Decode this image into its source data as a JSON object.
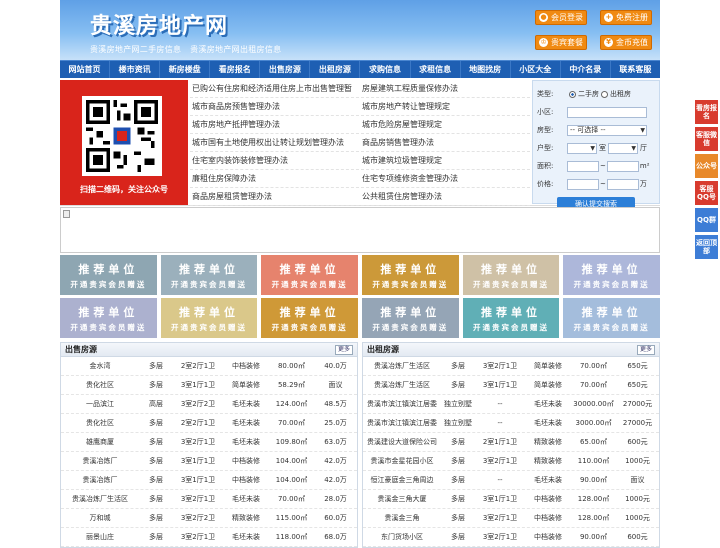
{
  "site": {
    "title": "贵溪房地产网",
    "tagline": [
      "贵溪房地产网二手房信息",
      "贵溪房地产网出租房信息"
    ]
  },
  "header_buttons": {
    "login": "会员登录",
    "register": "免费注册",
    "vip": "贵宾套餐",
    "recharge": "金币充值"
  },
  "nav": [
    "网站首页",
    "楼市资讯",
    "新房楼盘",
    "看房报名",
    "出售房源",
    "出租房源",
    "求购信息",
    "求租信息",
    "地图找房",
    "小区大全",
    "中介名录",
    "联系客服"
  ],
  "qr": {
    "caption": "扫描二维码，关注公众号"
  },
  "policy_links": [
    [
      "已购公有住房和经济适用住房上市出售管理暂",
      "房屋建筑工程质量保修办法"
    ],
    [
      "城市商品房预售管理办法",
      "城市房地产转让管理规定"
    ],
    [
      "城市房地产抵押管理办法",
      "城市危险房屋管理规定"
    ],
    [
      "城市国有土地使用权出让转让规划管理办法",
      "商品房销售管理办法"
    ],
    [
      "住宅室内装饰装修管理办法",
      "城市建筑垃圾管理规定"
    ],
    [
      "廉租住房保障办法",
      "住宅专项维修资金管理办法"
    ],
    [
      "商品房屋租赁管理办法",
      "公共租赁住房管理办法"
    ]
  ],
  "search": {
    "type_label": "类型:",
    "type_options": [
      "二手房",
      "出租房"
    ],
    "community_label": "小区:",
    "house_type_label": "房型:",
    "house_type_value": "-- 可选择 --",
    "layout_label": "户型:",
    "room_unit": "室",
    "hall_unit": "厅",
    "area_label": "面积:",
    "area_unit": "m²",
    "price_label": "价格:",
    "price_unit": "万",
    "submit": "确认提交搜索"
  },
  "recommend": {
    "title": "推荐单位",
    "subtitle": "开通贵宾会员赠送",
    "colors": [
      "#7f9aa8",
      "#8ea6b3",
      "#e3735a",
      "#c58b1e",
      "#c9b99a",
      "#a2aed6",
      "#a1a7c9",
      "#d5c17a",
      "#c98b1c",
      "#8799ad",
      "#4ba5ad",
      "#98b4d8"
    ]
  },
  "sale": {
    "title": "出售房源",
    "more": "更多",
    "rows": [
      [
        "金水湾",
        "多层",
        "2室2厅1卫",
        "中档装修",
        "80.00㎡",
        "40.0万"
      ],
      [
        "贵化社区",
        "多层",
        "3室1厅1卫",
        "简单装修",
        "58.29㎡",
        "面议"
      ],
      [
        "一品滨江",
        "高层",
        "3室2厅2卫",
        "毛坯未装",
        "124.00㎡",
        "48.5万"
      ],
      [
        "贵化社区",
        "多层",
        "2室2厅1卫",
        "毛坯未装",
        "70.00㎡",
        "25.0万"
      ],
      [
        "雄鹰商厦",
        "多层",
        "3室2厅1卫",
        "毛坯未装",
        "109.80㎡",
        "63.0万"
      ],
      [
        "贵溪冶炼厂",
        "多层",
        "3室1厅1卫",
        "中档装修",
        "104.00㎡",
        "42.0万"
      ],
      [
        "贵溪冶炼厂",
        "多层",
        "3室1厅1卫",
        "中档装修",
        "104.00㎡",
        "42.0万"
      ],
      [
        "贵溪冶炼厂生活区",
        "多层",
        "3室2厅1卫",
        "毛坯未装",
        "70.00㎡",
        "28.0万"
      ],
      [
        "万和城",
        "多层",
        "3室2厅2卫",
        "精致装修",
        "115.00㎡",
        "60.0万"
      ],
      [
        "丽景山庄",
        "多层",
        "3室2厅1卫",
        "毛坯未装",
        "118.00㎡",
        "68.0万"
      ]
    ]
  },
  "rent": {
    "title": "出租房源",
    "more": "更多",
    "rows": [
      [
        "贵溪冶炼厂生活区",
        "多层",
        "3室2厅1卫",
        "简单装修",
        "70.00㎡",
        "650元"
      ],
      [
        "贵溪冶炼厂生活区",
        "多层",
        "3室1厅1卫",
        "简单装修",
        "70.00㎡",
        "650元"
      ],
      [
        "贵溪市滨江镇滨江居委",
        "独立别墅",
        "--",
        "毛坯未装",
        "30000.00㎡",
        "27000元"
      ],
      [
        "贵溪市滨江镇滨江居委",
        "独立别墅",
        "--",
        "毛坯未装",
        "3000.00㎡",
        "27000元"
      ],
      [
        "贵溪建设大道保险公司",
        "多层",
        "2室1厅1卫",
        "精致装修",
        "65.00㎡",
        "600元"
      ],
      [
        "贵溪市金星花园小区",
        "多层",
        "3室2厅1卫",
        "精致装修",
        "110.00㎡",
        "1000元"
      ],
      [
        "恒江豪庭金三角周边",
        "多层",
        "--",
        "毛坯未装",
        "90.00㎡",
        "面议"
      ],
      [
        "贵溪金三角大厦",
        "多层",
        "3室1厅1卫",
        "中档装修",
        "128.00㎡",
        "1000元"
      ],
      [
        "贵溪金三角",
        "多层",
        "3室2厅1卫",
        "中档装修",
        "128.00㎡",
        "1000元"
      ],
      [
        "东门货场小区",
        "多层",
        "3室2厅1卫",
        "中档装修",
        "90.00㎡",
        "600元"
      ]
    ]
  },
  "side_buttons": [
    "看房报名",
    "客服微信",
    "公众号",
    "客服QQ号",
    "QQ群",
    "返回顶部"
  ],
  "side_colors": [
    "#d83b2e",
    "#d83b2e",
    "#e8892a",
    "#d83b2e",
    "#3d7dd6",
    "#3d7dd6"
  ]
}
